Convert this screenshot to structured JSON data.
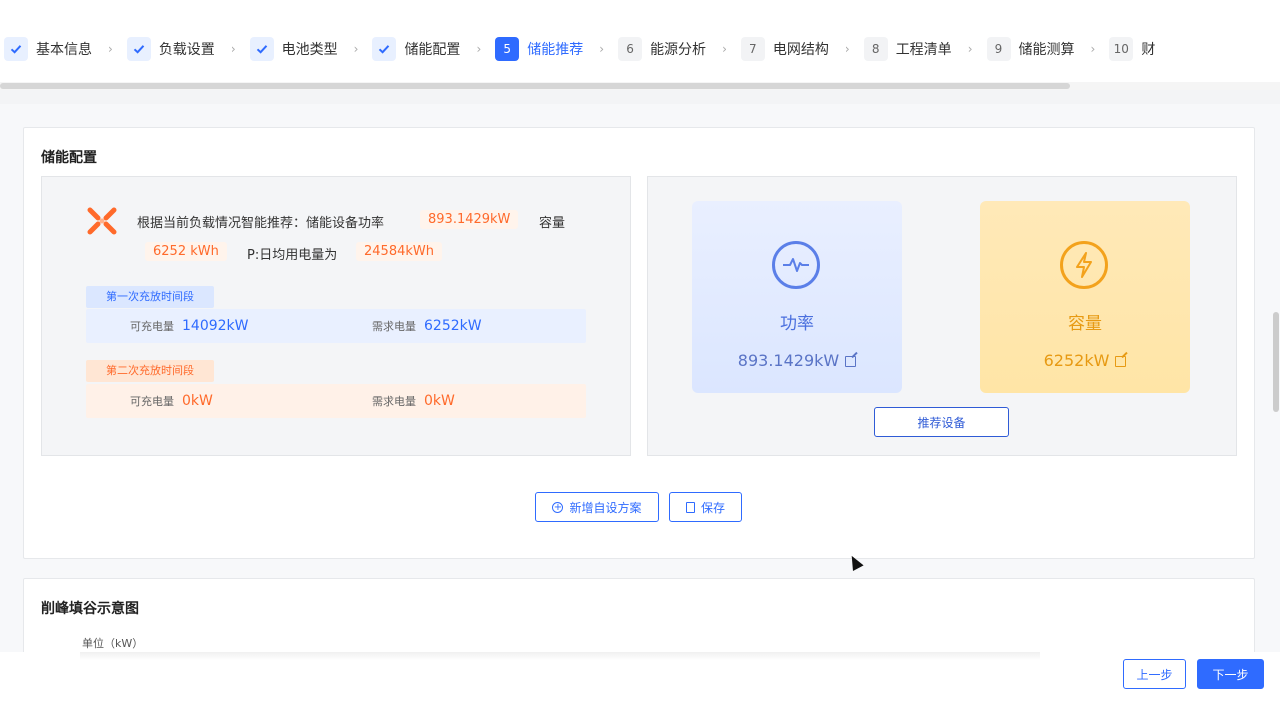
{
  "stepper": {
    "steps": [
      {
        "num": "",
        "label": "基本信息",
        "state": "done"
      },
      {
        "num": "",
        "label": "负载设置",
        "state": "done"
      },
      {
        "num": "",
        "label": "电池类型",
        "state": "done"
      },
      {
        "num": "",
        "label": "储能配置",
        "state": "done"
      },
      {
        "num": "5",
        "label": "储能推荐",
        "state": "active"
      },
      {
        "num": "6",
        "label": "能源分析",
        "state": "todo"
      },
      {
        "num": "7",
        "label": "电网结构",
        "state": "todo"
      },
      {
        "num": "8",
        "label": "工程清单",
        "state": "todo"
      },
      {
        "num": "9",
        "label": "储能测算",
        "state": "todo"
      },
      {
        "num": "10",
        "label": "财",
        "state": "todo"
      }
    ]
  },
  "config_card": {
    "title": "储能配置",
    "recommendation": {
      "lead": "根据当前负载情况智能推荐：储能设备功率",
      "power_value": "893.1429kW",
      "capacity_label": "容量",
      "capacity_value": "6252 kWh",
      "daily_label": "P:日均用电量为",
      "daily_value": "24584kWh"
    },
    "periods": [
      {
        "tag": "第一次充放时间段",
        "chargeable_label": "可充电量",
        "chargeable_value": "14092kW",
        "demand_label": "需求电量",
        "demand_value": "6252kW",
        "tone": "blue"
      },
      {
        "tag": "第二次充放时间段",
        "chargeable_label": "可充电量",
        "chargeable_value": "0kW",
        "demand_label": "需求电量",
        "demand_value": "0kW",
        "tone": "orange"
      }
    ],
    "metrics": {
      "power": {
        "title": "功率",
        "value": "893.1429kW",
        "icon": "pulse-icon"
      },
      "capacity": {
        "title": "容量",
        "value": "6252kW",
        "icon": "lightning-icon"
      }
    },
    "recommend_button": "推荐设备",
    "add_plan_button": "新增自设方案",
    "save_button": "保存"
  },
  "chart_card": {
    "title": "削峰填谷示意图",
    "unit_label": "单位（kW）"
  },
  "footer": {
    "prev_button": "上一步",
    "next_button": "下一步"
  },
  "colors": {
    "primary": "#2f6bff",
    "orange": "#ff6a2b",
    "gold": "#e79a13"
  }
}
